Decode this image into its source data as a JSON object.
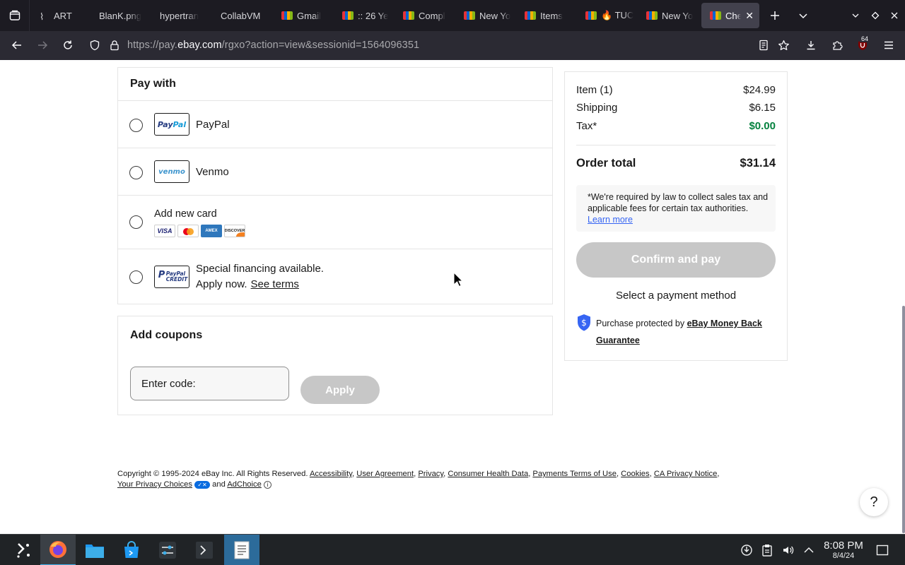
{
  "browser": {
    "tabs": [
      {
        "label": "ART",
        "favicon": "wave-icon"
      },
      {
        "label": "BlanK.png",
        "favicon": "none"
      },
      {
        "label": "hypertran",
        "favicon": "none"
      },
      {
        "label": "CollabVM",
        "favicon": "none"
      },
      {
        "label": "Gmail",
        "favicon": "ebay-icon"
      },
      {
        "label": ":: 26 Ye",
        "favicon": "ebay-icon"
      },
      {
        "label": "Compl",
        "favicon": "ebay-icon"
      },
      {
        "label": "New Yo",
        "favicon": "ebay-icon"
      },
      {
        "label": "Items",
        "favicon": "ebay-icon"
      },
      {
        "label": "🔥 TUC",
        "favicon": "ebay-icon"
      },
      {
        "label": "New Yo",
        "favicon": "ebay-icon"
      },
      {
        "label": "Chec",
        "favicon": "ebay-icon",
        "active": true
      }
    ],
    "url_prefix": "https://pay.",
    "url_domain": "ebay.com",
    "url_suffix": "/rgxo?action=view&sessionid=1564096351",
    "extension_badge": "64"
  },
  "pay_with": {
    "title": "Pay with",
    "options": [
      {
        "label": "PayPal",
        "logo_pay": "Pay",
        "logo_pal": "Pal"
      },
      {
        "label": "Venmo",
        "logo": "venmo"
      },
      {
        "label": "Add new card",
        "cards": [
          "VISA",
          "mastercard",
          "AMERICAN EXPRESS",
          "DISCOVER"
        ]
      },
      {
        "label_line1": "Special financing available.",
        "label_line2": "Apply now.",
        "link": "See terms",
        "logo_line1": "PayPal",
        "logo_line2": "CREDIT"
      }
    ]
  },
  "coupons": {
    "title": "Add coupons",
    "input_placeholder": "Enter code:",
    "apply_label": "Apply"
  },
  "summary": {
    "item_label": "Item (1)",
    "item_value": "$24.99",
    "shipping_label": "Shipping",
    "shipping_value": "$6.15",
    "tax_label": "Tax*",
    "tax_value": "$0.00",
    "total_label": "Order total",
    "total_value": "$31.14",
    "tax_note": "*We're required by law to collect sales tax and applicable fees for certain tax authorities.",
    "tax_note_link": "Learn more",
    "confirm_label": "Confirm and pay",
    "select_message": "Select a payment method",
    "protect_text": "Purchase protected by",
    "protect_link": "eBay Money Back Guarantee"
  },
  "footer": {
    "copyright": "Copyright © 1995-2024 eBay Inc. All Rights Reserved.",
    "links": [
      "Accessibility",
      "User Agreement",
      "Privacy",
      "Consumer Health Data",
      "Payments Terms of Use",
      "Cookies",
      "CA Privacy Notice"
    ],
    "privacy_choices": "Your Privacy Choices",
    "and_text": "and",
    "adchoice": "AdChoice"
  },
  "help_label": "?",
  "taskbar": {
    "time": "8:08 PM",
    "date": "8/4/24"
  },
  "colors": {
    "accent_green": "#05823f",
    "link_blue": "#3665f3",
    "disabled_button": "#c7c7c7",
    "browser_dark": "#1c1b22"
  }
}
